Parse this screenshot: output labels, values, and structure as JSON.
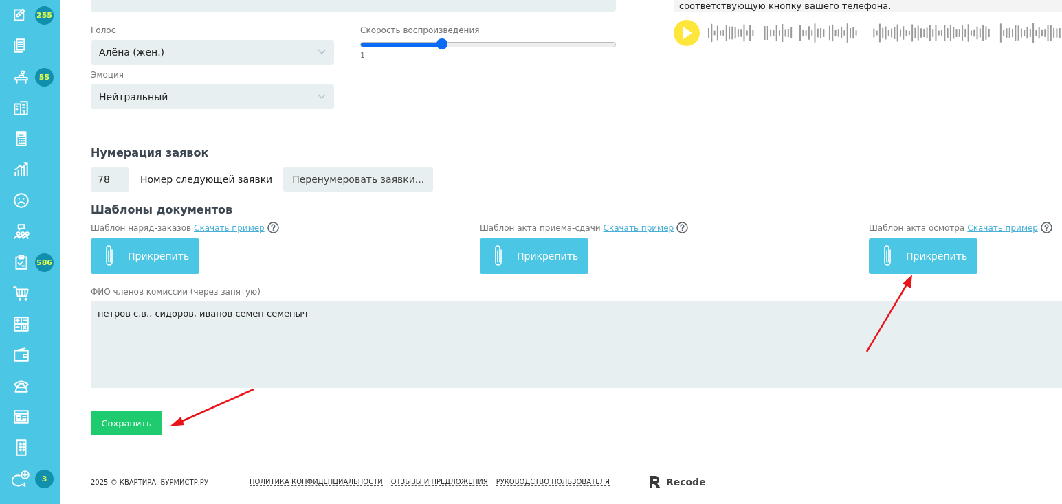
{
  "sidebar": {
    "items": [
      {
        "kind": "edit",
        "badge": "255"
      },
      {
        "kind": "documents"
      },
      {
        "kind": "desk",
        "badge": "55"
      },
      {
        "kind": "building"
      },
      {
        "kind": "calculator"
      },
      {
        "kind": "chart"
      },
      {
        "kind": "face"
      },
      {
        "kind": "people"
      },
      {
        "kind": "clipboard",
        "badge": "586"
      },
      {
        "kind": "cart"
      },
      {
        "kind": "math"
      },
      {
        "kind": "wallet"
      },
      {
        "kind": "phone"
      },
      {
        "kind": "browser"
      },
      {
        "kind": "mobile"
      },
      {
        "kind": "chat",
        "badge": "3"
      }
    ]
  },
  "voice": {
    "voice_label": "Голос",
    "voice_value": "Алёна (жен.)",
    "emotion_label": "Эмоция",
    "emotion_value": "Нейтральный",
    "speed": {
      "label": "Скорость воспроизведения",
      "level": 0.32,
      "reading": "1"
    }
  },
  "preview": {
    "text": "соответствующую кнопку вашего телефона."
  },
  "numbering": {
    "heading": "Нумерация заявок",
    "value": "78",
    "label": "Номер следующей заявки",
    "button": "Перенумеровать заявки..."
  },
  "templates": {
    "heading": "Шаблоны документов",
    "items": [
      {
        "label": "Шаблон наряд-заказов",
        "link": "Скачать пример",
        "button": "Прикрепить"
      },
      {
        "label": "Шаблон акта приема-сдачи",
        "link": "Скачать пример",
        "button": "Прикрепить"
      },
      {
        "label": "Шаблон акта осмотра",
        "link": "Скачать пример",
        "button": "Прикрепить"
      }
    ]
  },
  "commission": {
    "label": "ФИО членов комиссии (через запятую)",
    "value": "петров с.в., сидоров, иванов семен семеныч"
  },
  "save_button": "Сохранить",
  "footer": {
    "copyright": "2025 © КВАРТИРА. БУРМИСТР.РУ",
    "links": [
      "ПОЛИТИКА КОНФИДЕНЦИАЛЬНОСТИ",
      "ОТЗЫВЫ И ПРЕДЛОЖЕНИЯ",
      "РУКОВОДСТВО ПОЛЬЗОВАТЕЛЯ"
    ],
    "brand": "Recode"
  }
}
